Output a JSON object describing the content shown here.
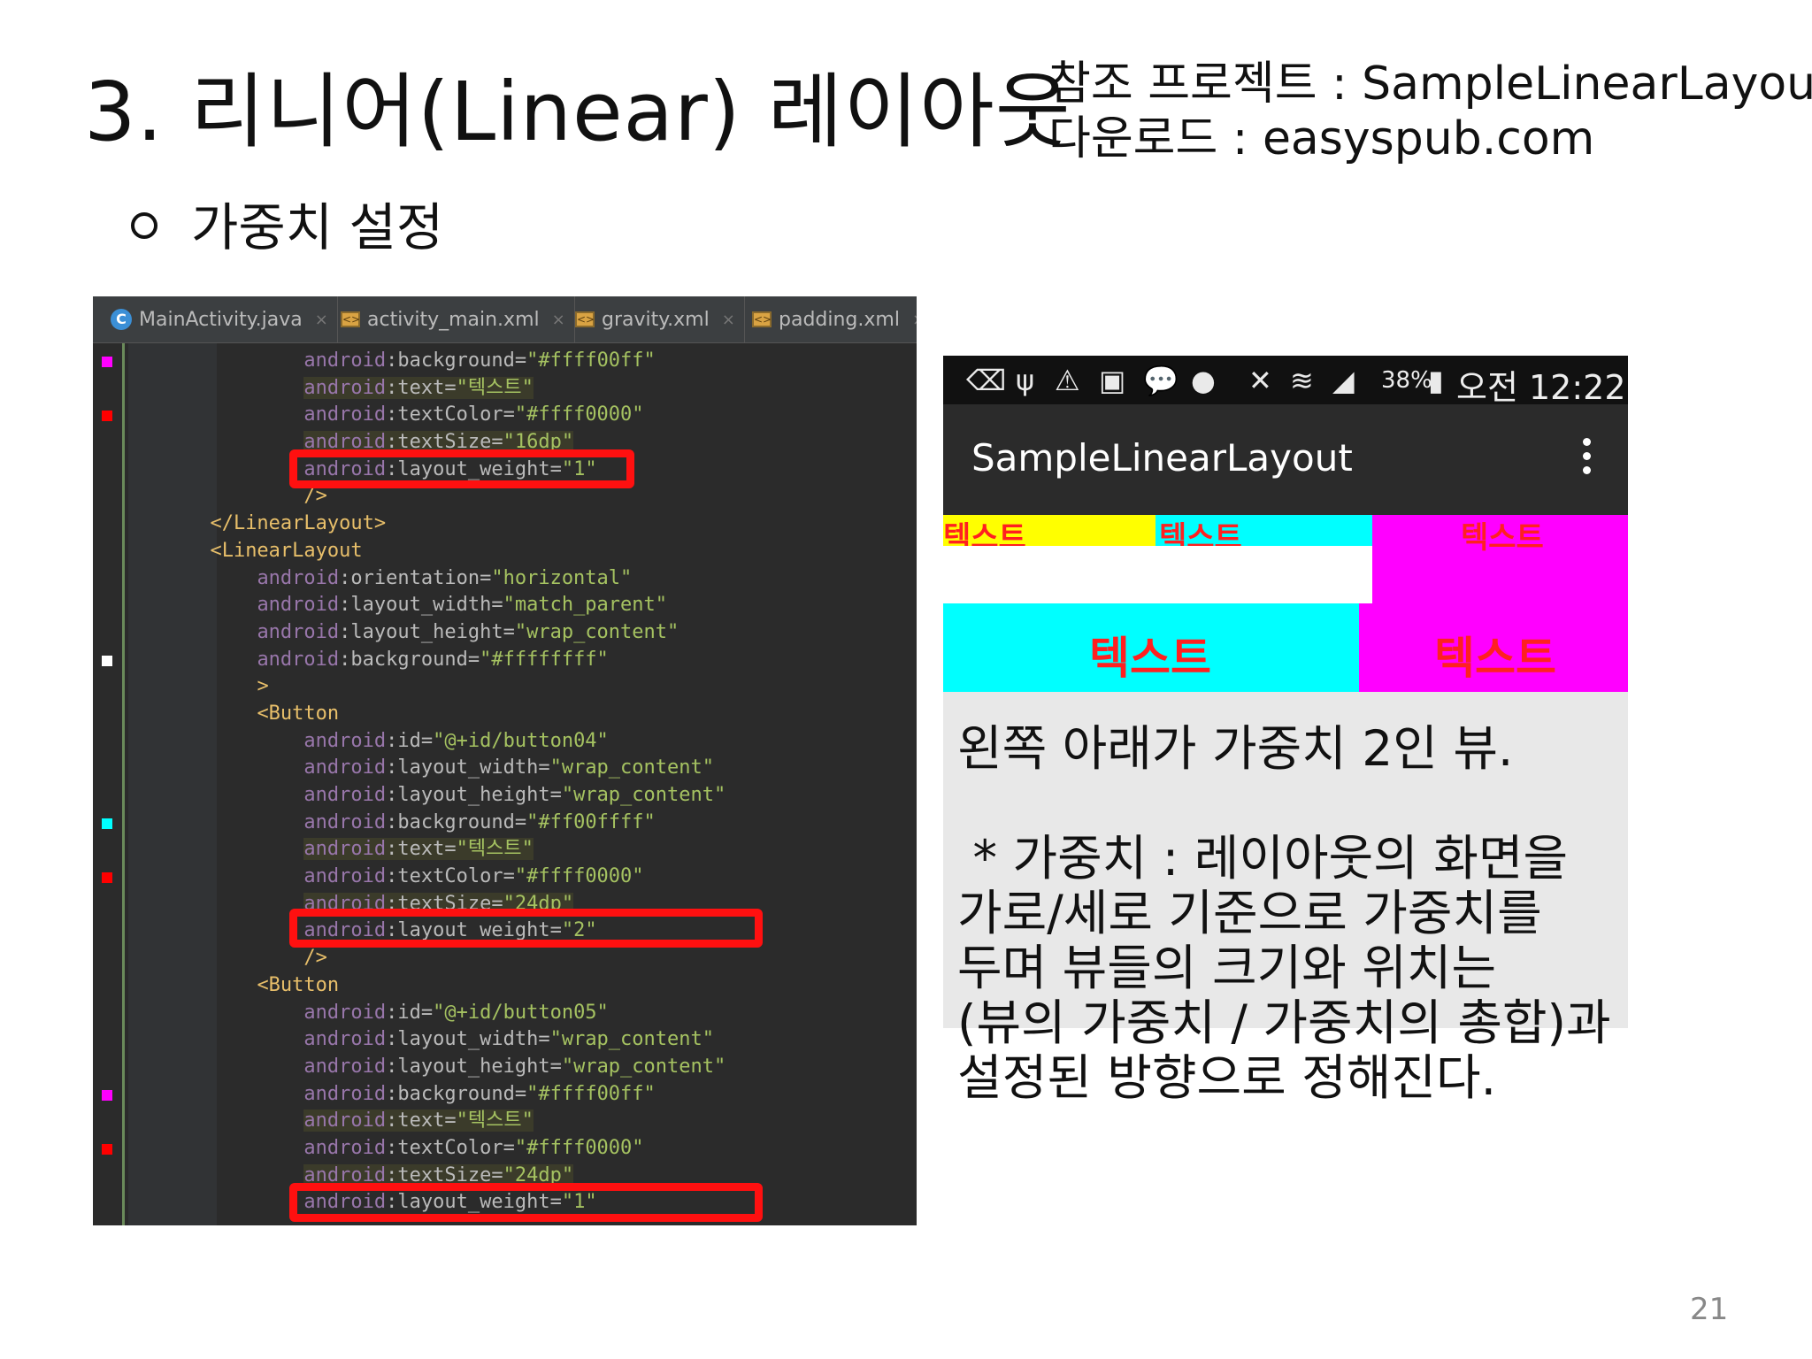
{
  "slide": {
    "title": "3. 리니어(Linear) 레이아웃",
    "ref_line1": "참조 프로젝트 : SampleLinearLayout",
    "ref_line2": "다운로드 : easyspub.com",
    "bullet": "가중치 설정",
    "page_number": "21"
  },
  "ide": {
    "tabs": [
      {
        "label": "MainActivity.java",
        "icon": "java-class-icon"
      },
      {
        "label": "activity_main.xml",
        "icon": "xml-file-icon"
      },
      {
        "label": "gravity.xml",
        "icon": "xml-file-icon"
      },
      {
        "label": "padding.xml",
        "icon": "xml-file-icon"
      }
    ],
    "close_glyph": "×",
    "code_lines": [
      {
        "indent": "            ",
        "ns": "android",
        "attr": ":background=",
        "val": "\"#ffff00ff\"",
        "marker": "#ff00ff"
      },
      {
        "indent": "            ",
        "ns": "android",
        "attr": ":text=",
        "val": "\"텍스트\"",
        "hl": true
      },
      {
        "indent": "            ",
        "ns": "android",
        "attr": ":textColor=",
        "val": "\"#ffff0000\"",
        "marker": "#ff0000"
      },
      {
        "indent": "            ",
        "ns": "android",
        "attr": ":textSize=",
        "val": "\"16dp\"",
        "hl": true
      },
      {
        "indent": "            ",
        "ns": "android",
        "attr": ":layout_weight=",
        "val": "\"1\""
      },
      {
        "indent": "            ",
        "tag": "/>"
      },
      {
        "indent": "    ",
        "tag": "</LinearLayout>"
      },
      {
        "indent": "    ",
        "tag": "<LinearLayout"
      },
      {
        "indent": "        ",
        "ns": "android",
        "attr": ":orientation=",
        "val": "\"horizontal\""
      },
      {
        "indent": "        ",
        "ns": "android",
        "attr": ":layout_width=",
        "val": "\"match_parent\""
      },
      {
        "indent": "        ",
        "ns": "android",
        "attr": ":layout_height=",
        "val": "\"wrap_content\""
      },
      {
        "indent": "        ",
        "ns": "android",
        "attr": ":background=",
        "val": "\"#ffffffff\"",
        "marker": "#ffffff"
      },
      {
        "indent": "        ",
        "tag": ">"
      },
      {
        "indent": "        ",
        "tag": "<Button"
      },
      {
        "indent": "            ",
        "ns": "android",
        "attr": ":id=",
        "val": "\"@+id/button04\""
      },
      {
        "indent": "            ",
        "ns": "android",
        "attr": ":layout_width=",
        "val": "\"wrap_content\""
      },
      {
        "indent": "            ",
        "ns": "android",
        "attr": ":layout_height=",
        "val": "\"wrap_content\""
      },
      {
        "indent": "            ",
        "ns": "android",
        "attr": ":background=",
        "val": "\"#ff00ffff\"",
        "marker": "#00ffff"
      },
      {
        "indent": "            ",
        "ns": "android",
        "attr": ":text=",
        "val": "\"텍스트\"",
        "hl": true
      },
      {
        "indent": "            ",
        "ns": "android",
        "attr": ":textColor=",
        "val": "\"#ffff0000\"",
        "marker": "#ff0000"
      },
      {
        "indent": "            ",
        "ns": "android",
        "attr": ":textSize=",
        "val": "\"24dp\"",
        "hl": true
      },
      {
        "indent": "            ",
        "ns": "android",
        "attr": ":layout_weight=",
        "val": "\"2\""
      },
      {
        "indent": "            ",
        "tag": "/>"
      },
      {
        "indent": "        ",
        "tag": "<Button"
      },
      {
        "indent": "            ",
        "ns": "android",
        "attr": ":id=",
        "val": "\"@+id/button05\""
      },
      {
        "indent": "            ",
        "ns": "android",
        "attr": ":layout_width=",
        "val": "\"wrap_content\""
      },
      {
        "indent": "            ",
        "ns": "android",
        "attr": ":layout_height=",
        "val": "\"wrap_content\""
      },
      {
        "indent": "            ",
        "ns": "android",
        "attr": ":background=",
        "val": "\"#ffff00ff\"",
        "marker": "#ff00ff"
      },
      {
        "indent": "            ",
        "ns": "android",
        "attr": ":text=",
        "val": "\"텍스트\"",
        "hl": true
      },
      {
        "indent": "            ",
        "ns": "android",
        "attr": ":textColor=",
        "val": "\"#ffff0000\"",
        "marker": "#ff0000"
      },
      {
        "indent": "            ",
        "ns": "android",
        "attr": ":textSize=",
        "val": "\"24dp\"",
        "hl": true
      },
      {
        "indent": "            ",
        "ns": "android",
        "attr": ":layout_weight=",
        "val": "\"1\""
      }
    ]
  },
  "phone": {
    "battery": "38%",
    "clock": "오전 12:22",
    "app_title": "SampleLinearLayout",
    "row1": [
      "텍스트",
      "텍스트",
      "텍스트"
    ],
    "row2": [
      "텍스트",
      "텍스트"
    ],
    "colors": {
      "yellow": "#ffff00",
      "cyan": "#00ffff",
      "magenta": "#ff00ff",
      "text_red": "#ff2020"
    }
  },
  "caption": "왼쪽 아래가 가중치 2인 뷰.\n\n * 가중치 : 레이아웃의 화면을\n가로/세로 기준으로 가중치를\n두며 뷰들의 크기와 위치는\n(뷰의 가중치 / 가중치의 총합)과\n설정된 방향으로 정해진다."
}
